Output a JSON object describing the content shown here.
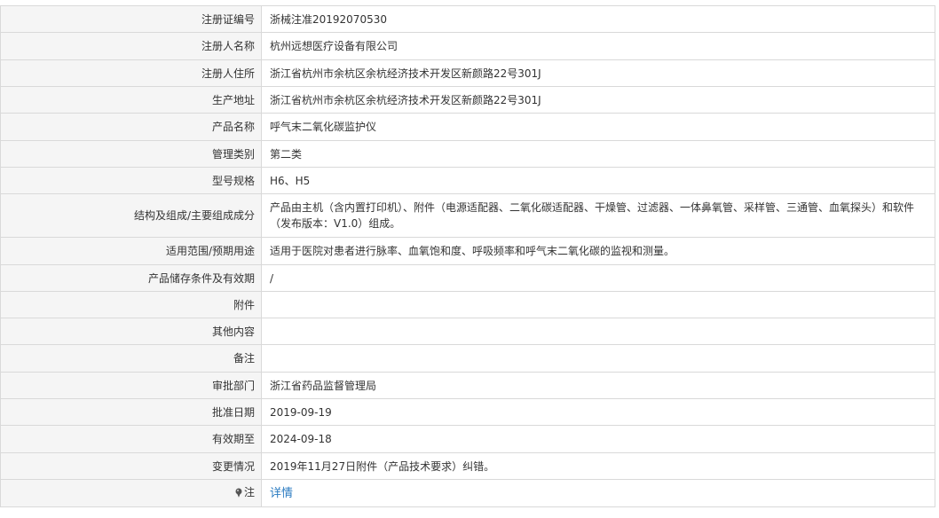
{
  "rows": [
    {
      "label": "注册证编号",
      "value": "浙械注准20192070530"
    },
    {
      "label": "注册人名称",
      "value": "杭州远想医疗设备有限公司"
    },
    {
      "label": "注册人住所",
      "value": "浙江省杭州市余杭区余杭经济技术开发区新颜路22号301J"
    },
    {
      "label": "生产地址",
      "value": "浙江省杭州市余杭区余杭经济技术开发区新颜路22号301J"
    },
    {
      "label": "产品名称",
      "value": "呼气末二氧化碳监护仪"
    },
    {
      "label": "管理类别",
      "value": "第二类"
    },
    {
      "label": "型号规格",
      "value": "H6、H5"
    },
    {
      "label": "结构及组成/主要组成成分",
      "value": "产品由主机（含内置打印机）、附件（电源适配器、二氧化碳适配器、干燥管、过滤器、一体鼻氧管、采样管、三通管、血氧探头）和软件（发布版本：V1.0）组成。"
    },
    {
      "label": "适用范围/预期用途",
      "value": "适用于医院对患者进行脉率、血氧饱和度、呼吸频率和呼气末二氧化碳的监视和测量。"
    },
    {
      "label": "产品储存条件及有效期",
      "value": "/"
    },
    {
      "label": "附件",
      "value": ""
    },
    {
      "label": "其他内容",
      "value": ""
    },
    {
      "label": "备注",
      "value": ""
    },
    {
      "label": "审批部门",
      "value": "浙江省药品监督管理局"
    },
    {
      "label": "批准日期",
      "value": "2019-09-19"
    },
    {
      "label": "有效期至",
      "value": "2024-09-18"
    },
    {
      "label": "变更情况",
      "value": "2019年11月27日附件（产品技术要求）纠错。"
    }
  ],
  "note": {
    "label": "注",
    "icon": "pin-icon",
    "link_text": "详情",
    "link_color": "#2a7bc1"
  }
}
